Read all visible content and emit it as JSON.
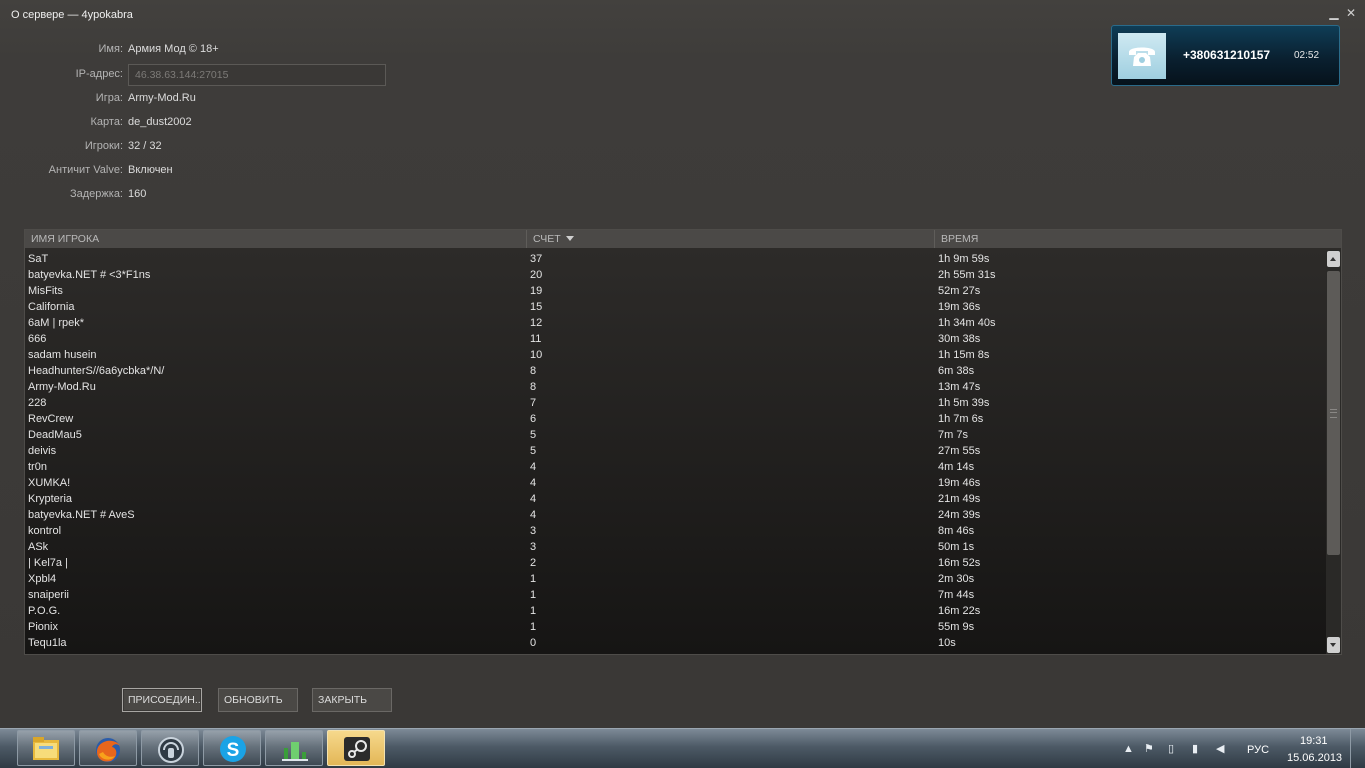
{
  "window": {
    "title": "О сервере — 4ypokabra",
    "min_glyph": "▁",
    "close_glyph": "✕"
  },
  "server_info": {
    "name_label": "Имя:",
    "name_value": "Армия Мод © 18+",
    "ip_label": "IP-адрес:",
    "ip_value": "46.38.63.144:27015",
    "game_label": "Игра:",
    "game_value": "Army-Mod.Ru",
    "map_label": "Карта:",
    "map_value": "de_dust2002",
    "players_label": "Игроки:",
    "players_value": "32 / 32",
    "vac_label": "Античит Valve:",
    "vac_value": "Включен",
    "latency_label": "Задержка:",
    "latency_value": "160"
  },
  "table": {
    "columns": [
      "ИМЯ ИГРОКА",
      "СЧЕТ",
      "ВРЕМЯ"
    ],
    "sorted_column": "СЧЕТ",
    "sort_direction": "descending",
    "rows": [
      {
        "name": "SaT",
        "score": "37",
        "time": "1h 9m 59s"
      },
      {
        "name": "batyevka.NET # <3*F1ns",
        "score": "20",
        "time": "2h 55m 31s"
      },
      {
        "name": "MisFits",
        "score": "19",
        "time": "52m 27s"
      },
      {
        "name": "California",
        "score": "15",
        "time": "19m 36s"
      },
      {
        "name": "6aM | rpek*",
        "score": "12",
        "time": "1h 34m 40s"
      },
      {
        "name": "666",
        "score": "11",
        "time": "30m 38s"
      },
      {
        "name": "sadam husein",
        "score": "10",
        "time": "1h 15m 8s"
      },
      {
        "name": "HeadhunterS//6a6ycbka*/N/",
        "score": "8",
        "time": "6m 38s"
      },
      {
        "name": "Army-Mod.Ru",
        "score": "8",
        "time": "13m 47s"
      },
      {
        "name": "228",
        "score": "7",
        "time": "1h 5m 39s"
      },
      {
        "name": "RevCrew",
        "score": "6",
        "time": "1h 7m 6s"
      },
      {
        "name": "DeadMau5",
        "score": "5",
        "time": "7m 7s"
      },
      {
        "name": "deivis",
        "score": "5",
        "time": "27m 55s"
      },
      {
        "name": "tr0n",
        "score": "4",
        "time": "4m 14s"
      },
      {
        "name": "XUMKA!",
        "score": "4",
        "time": "19m 46s"
      },
      {
        "name": "Krypteria",
        "score": "4",
        "time": "21m 49s"
      },
      {
        "name": "batyevka.NET # AveS",
        "score": "4",
        "time": "24m 39s"
      },
      {
        "name": "kontrol",
        "score": "3",
        "time": "8m 46s"
      },
      {
        "name": "ASk",
        "score": "3",
        "time": "50m 1s"
      },
      {
        "name": "| Kel7a |",
        "score": "2",
        "time": "16m 52s"
      },
      {
        "name": "Xpbl4",
        "score": "1",
        "time": "2m 30s"
      },
      {
        "name": "snaiperii",
        "score": "1",
        "time": "7m 44s"
      },
      {
        "name": "P.O.G.",
        "score": "1",
        "time": "16m 22s"
      },
      {
        "name": "Pionix",
        "score": "1",
        "time": "55m 9s"
      },
      {
        "name": "Tequ1la",
        "score": "0",
        "time": "10s"
      }
    ]
  },
  "buttons": {
    "join": "ПРИСОЕДИН...",
    "refresh": "ОБНОВИТЬ",
    "close": "ЗАКРЫТЬ"
  },
  "call_notification": {
    "number": "+380631210157",
    "duration": "02:52"
  },
  "taskbar": {
    "apps": [
      "file-explorer-icon",
      "firefox-icon",
      "teamspeak-icon",
      "skype-icon",
      "network-meter-icon",
      "steam-icon"
    ],
    "active_app": "steam-icon",
    "language": "РУС",
    "time": "19:31",
    "date": "15.06.2013"
  },
  "colors": {
    "window_bg": "#3d3b39",
    "table_header_bg": "#4b4947",
    "notification_bg": "#0a2030",
    "active_task": "#e3b757"
  }
}
